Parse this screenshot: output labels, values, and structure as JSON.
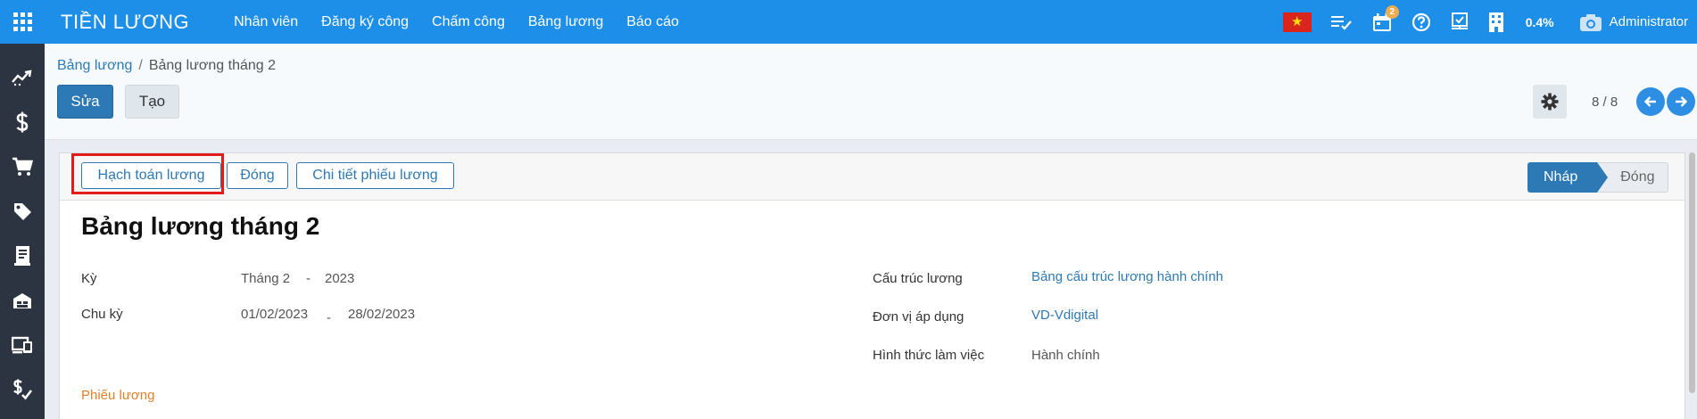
{
  "topbar": {
    "brand": "TIỀN LƯƠNG",
    "menu": [
      "Nhân viên",
      "Đăng ký công",
      "Chấm công",
      "Bảng lương",
      "Báo cáo"
    ],
    "notification_count": "2",
    "percent": "0.4%",
    "user": "Administrator"
  },
  "breadcrumb": {
    "parent": "Bảng lương",
    "separator": "/",
    "current": "Bảng lương tháng 2"
  },
  "actions": {
    "edit": "Sửa",
    "create": "Tạo"
  },
  "pager": "8 / 8",
  "form_buttons": {
    "accounting": "Hạch toán lương",
    "close": "Đóng",
    "payslip_detail": "Chi tiết phiếu lương"
  },
  "stages": {
    "active": "Nháp",
    "next": "Đóng"
  },
  "record": {
    "title": "Bảng lương tháng 2",
    "period_label": "Kỳ",
    "period_month": "Tháng 2",
    "period_year": "2023",
    "cycle_label": "Chu kỳ",
    "cycle_from": "01/02/2023",
    "cycle_to": "28/02/2023",
    "dash": "-",
    "structure_label": "Cấu trúc lương",
    "structure_value": "Bảng cấu trúc lương hành chính",
    "unit_label": "Đơn vị áp dụng",
    "unit_value": "VD-Vdigital",
    "work_form_label": "Hình thức làm việc",
    "work_form_value": "Hành chính",
    "payslip_section": "Phiếu lương"
  }
}
